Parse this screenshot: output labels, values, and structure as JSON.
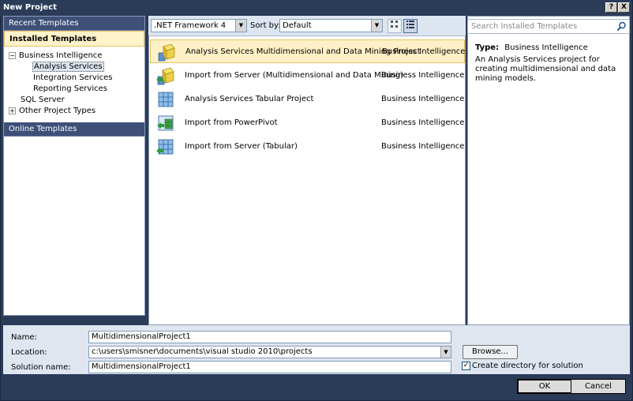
{
  "window": {
    "title": "New Project",
    "help_label": "?",
    "close_label": "X"
  },
  "left_pane": {
    "recent_templates": "Recent Templates",
    "installed_templates": "Installed Templates",
    "tree": [
      {
        "label": "Business Intelligence",
        "expander": "−"
      },
      {
        "label": "Analysis Services"
      },
      {
        "label": "Integration Services"
      },
      {
        "label": "Reporting Services"
      },
      {
        "label": "SQL Server"
      },
      {
        "label": "Other Project Types",
        "expander": "+"
      }
    ],
    "online_templates": "Online Templates"
  },
  "toolbar": {
    "framework": ".NET Framework 4",
    "sort_label": "Sort by:",
    "sort_value": "Default"
  },
  "search": {
    "placeholder": "Search Installed Templates"
  },
  "templates": [
    {
      "name": "Analysis Services Multidimensional and Data Mining Project",
      "type": "Business Intelligence"
    },
    {
      "name": "Import from Server (Multidimensional and Data Mining)",
      "type": "Business Intelligence"
    },
    {
      "name": "Analysis Services Tabular Project",
      "type": "Business Intelligence"
    },
    {
      "name": "Import from PowerPivot",
      "type": "Business Intelligence"
    },
    {
      "name": "Import from Server (Tabular)",
      "type": "Business Intelligence"
    }
  ],
  "details": {
    "type_label": "Type:",
    "type_value": "Business Intelligence",
    "description": "An Analysis Services project for creating multidimensional and data mining models."
  },
  "form": {
    "name_label": "Name:",
    "name_value": "MultidimensionalProject1",
    "location_label": "Location:",
    "location_value": "c:\\users\\smisner\\documents\\visual studio 2010\\projects",
    "solution_label": "Solution name:",
    "solution_value": "MultidimensionalProject1",
    "browse_label": "Browse...",
    "create_dir_label": "Create directory for solution",
    "create_dir_checked": true
  },
  "buttons": {
    "ok": "OK",
    "cancel": "Cancel"
  },
  "colors": {
    "chrome": "#2b3c59",
    "selection": "#fff1c6",
    "panel": "#dfe6f0"
  }
}
